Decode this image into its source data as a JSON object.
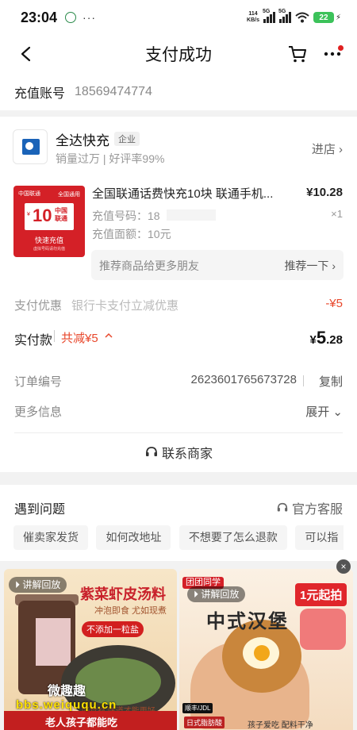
{
  "status_bar": {
    "time": "23:04",
    "more": "···",
    "speed_top": "114",
    "speed_bottom": "KB/s",
    "net1": "5G",
    "net2": "5G",
    "battery": "22"
  },
  "nav": {
    "title": "支付成功",
    "icons": [
      "back-arrow-icon",
      "cart-icon",
      "more-icon"
    ]
  },
  "recharge": {
    "label": "充值账号",
    "value": "18569474774"
  },
  "shop": {
    "name": "全达快充",
    "tag": "企业",
    "meta": "销量过万 | 好评率99%",
    "enter_label": "进店 ›"
  },
  "product": {
    "thumb": {
      "brand": "中国联通",
      "corner": "全国通用",
      "yen": "¥",
      "amount": "10",
      "carrier": "中国 联通",
      "fast": "快速充值",
      "note": "虚拟号码请勿充值"
    },
    "title": "全国联通话费快充10块 联通手机...",
    "price": "¥10.28",
    "line1_label": "充值号码：",
    "line1_value": "18",
    "line2": "充值面额：10元",
    "qty": "×1"
  },
  "recommend": {
    "text": "推荐商品给更多朋友",
    "button": "推荐一下 ›"
  },
  "payment": {
    "discount_label": "支付优惠",
    "discount_desc": "银行卡支付立减优惠",
    "discount_value": "-¥5",
    "actual_label": "实付款",
    "saved": "共减¥5",
    "saved_arrow": "^",
    "actual_yen": "¥",
    "actual_big": "5",
    "actual_small": ".28"
  },
  "order": {
    "number_label": "订单编号",
    "number_value": "2623601765673728",
    "copy": "复制",
    "more_label": "更多信息",
    "expand": "展开 ⌄"
  },
  "contact": {
    "label": "联系商家"
  },
  "problem": {
    "title": "遇到问题",
    "service": "官方客服",
    "chips": [
      "催卖家发货",
      "如何改地址",
      "不想要了怎么退款",
      "可以指"
    ]
  },
  "feed": {
    "left": {
      "tag": "讲解回放",
      "title": "紫菜虾皮汤料",
      "sub": "冲泡即食 尤如现煮",
      "badge": "不添加一粒盐",
      "bottom_small": "好食材 味道才能更好",
      "bottom": "老人孩子都能吃"
    },
    "right": {
      "label": "团团同学",
      "tag": "讲解回放",
      "title": "中式汉堡",
      "promo": "1元起拍",
      "brand": "顺丰/JDL",
      "bottom_left": "日式脂肪酸",
      "bottom_right": "孩子爱吃 配料干净"
    },
    "close": "×"
  },
  "watermark": {
    "line1": "微趣趣",
    "line2": "bbs.weiququ.cn"
  },
  "colors": {
    "accent_red": "#e8472b",
    "battery_green": "#3cc25a",
    "unicom_red": "#d42027"
  }
}
